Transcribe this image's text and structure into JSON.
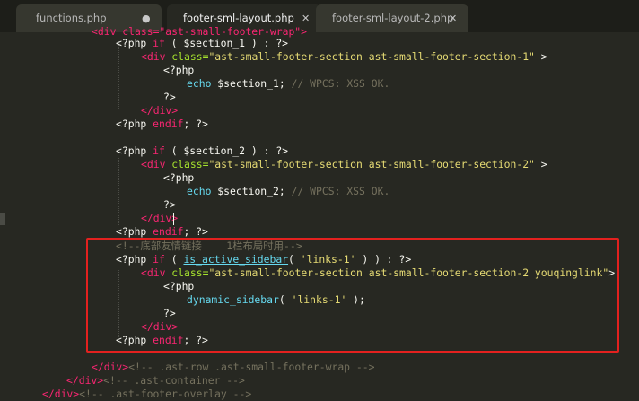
{
  "tabs": [
    {
      "label": "functions.php",
      "button": "●",
      "active": false
    },
    {
      "label": "footer-sml-layout.php",
      "button": "✕",
      "active": true
    },
    {
      "label": "footer-sml-layout-2.php",
      "button": "✕",
      "active": false
    }
  ],
  "code": {
    "top": "<div class=\"ast-small-footer-wrap\">",
    "s1_if_kw": "<?php",
    "s1_if_if": "if",
    "s1_if_cond": " ( $section_1 ) : ?>",
    "s1_div_tag": "<div",
    "s1_div_attr": "class=",
    "s1_div_val": "\"ast-small-footer-section ast-small-footer-section-1\"",
    "s1_div_end": ">",
    "s1_php": "<?php",
    "s1_echo": "echo",
    "s1_var": " $section_1; ",
    "s1_cmt": "// WPCS: XSS OK.",
    "s1_close": "?>",
    "s1_enddiv": "</div>",
    "s1_endif_kw": "<?php",
    "s1_endif_kw2": "endif",
    "s1_endif_end": "; ?>",
    "s2_if_kw": "<?php",
    "s2_if_if": "if",
    "s2_if_cond": " ( $section_2 ) : ?>",
    "s2_div_tag": "<div",
    "s2_div_attr": "class=",
    "s2_div_val": "\"ast-small-footer-section ast-small-footer-section-2\"",
    "s2_div_end": ">",
    "s2_php": "<?php",
    "s2_echo": "echo",
    "s2_var": " $section_2; ",
    "s2_cmt": "// WPCS: XSS OK.",
    "s2_close": "?>",
    "s2_enddiv": "</div>",
    "s2_endif_kw": "<?php",
    "s2_endif_kw2": "endif",
    "s2_endif_end": "; ?>",
    "links_cmt": "<!--底部友情链接    1栏布局时用-->",
    "l_if_kw": "<?php",
    "l_if_if": "if",
    "l_if_p1": " ( ",
    "l_if_func": "is_active_sidebar",
    "l_if_p2": "( ",
    "l_if_arg": "'links-1'",
    "l_if_p3": " ) ) : ?>",
    "l_div_tag": "<div",
    "l_div_attr": "class=",
    "l_div_val": "\"ast-small-footer-section ast-small-footer-section-2 youqinglink\"",
    "l_div_end": ">",
    "l_php": "<?php",
    "l_func": "dynamic_sidebar",
    "l_p1": "( ",
    "l_arg": "'links-1'",
    "l_p2": " );",
    "l_close": "?>",
    "l_enddiv": "</div>",
    "l_endif_kw": "<?php",
    "l_endif_kw2": "endif",
    "l_endif_end": "; ?>",
    "end1_tag": "</div>",
    "end1_cmt": "<!-- .ast-row .ast-small-footer-wrap -->",
    "end2_tag": "</div>",
    "end2_cmt": "<!-- .ast-container -->",
    "end3_tag": "</div>",
    "end3_cmt": "<!-- .ast-footer-overlay -->"
  }
}
